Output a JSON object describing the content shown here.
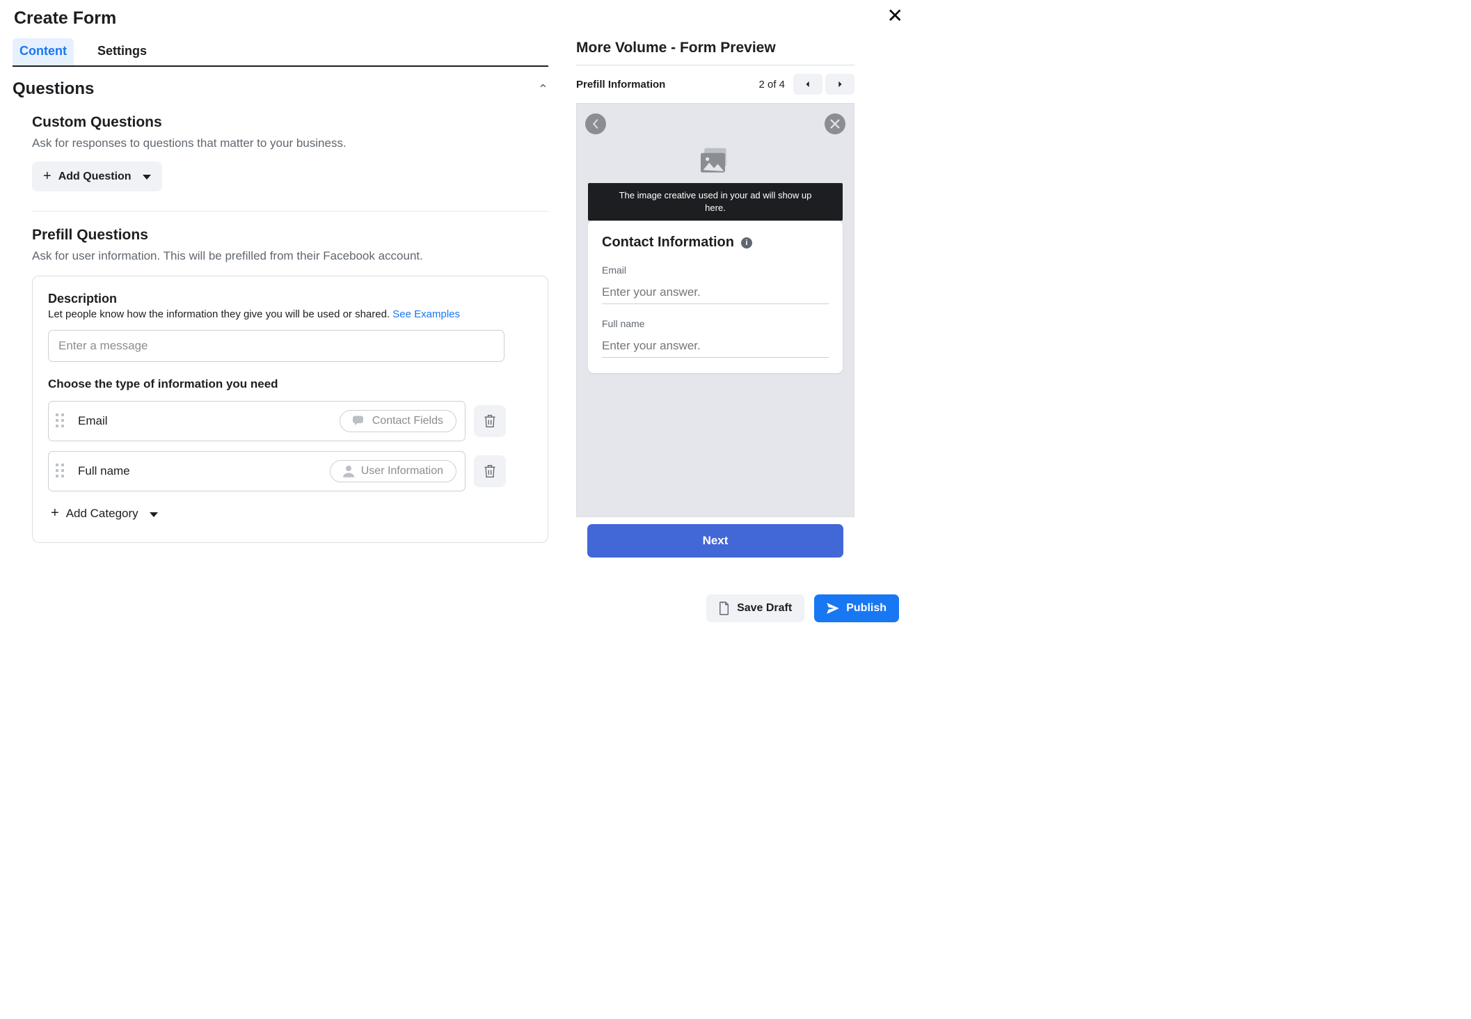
{
  "title": "Create Form",
  "tabs": {
    "content": "Content",
    "settings": "Settings"
  },
  "questions": {
    "heading": "Questions",
    "custom": {
      "heading": "Custom Questions",
      "desc": "Ask for responses to questions that matter to your business.",
      "add": "Add Question"
    },
    "prefill": {
      "heading": "Prefill Questions",
      "desc": "Ask for user information. This will be prefilled from their Facebook account.",
      "card": {
        "title": "Description",
        "desc_prefix": "Let people know how the information they give you will be used or shared. ",
        "see_examples": "See Examples",
        "placeholder": "Enter a message",
        "choose_label": "Choose the type of information you need",
        "rows": [
          {
            "name": "Email",
            "tag": "Contact Fields"
          },
          {
            "name": "Full name",
            "tag": "User Information"
          }
        ],
        "add_category": "Add Category"
      }
    }
  },
  "right": {
    "heading": "More Volume - Form Preview",
    "section": "Prefill Information",
    "page_text": "2 of 4",
    "tooltip": "The image creative used in your ad will show up here.",
    "card_title": "Contact Information",
    "fields": [
      {
        "label": "Email",
        "placeholder": "Enter your answer."
      },
      {
        "label": "Full name",
        "placeholder": "Enter your answer."
      }
    ],
    "next": "Next"
  },
  "footer": {
    "save_draft": "Save Draft",
    "publish": "Publish"
  }
}
